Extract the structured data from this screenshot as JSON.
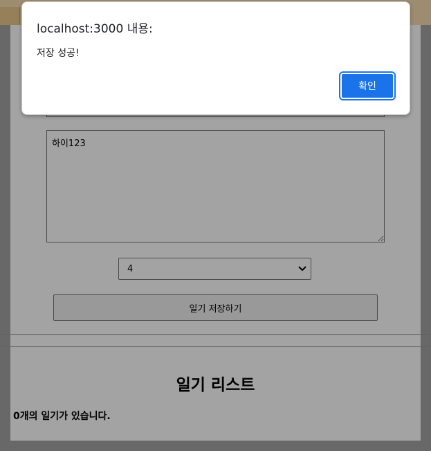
{
  "dialog": {
    "title": "localhost:3000 내용:",
    "message": "저장 성공!",
    "ok_label": "확인"
  },
  "editor": {
    "content_value": "하이123",
    "emotion_selected": "4",
    "save_label": "일기 저장하기"
  },
  "list": {
    "title": "일기 리스트",
    "count": "0",
    "count_suffix": "개의 일기가 있습니다."
  },
  "colors": {
    "primary_button": "#1a73e8",
    "overlay": "#a3a3a3"
  }
}
